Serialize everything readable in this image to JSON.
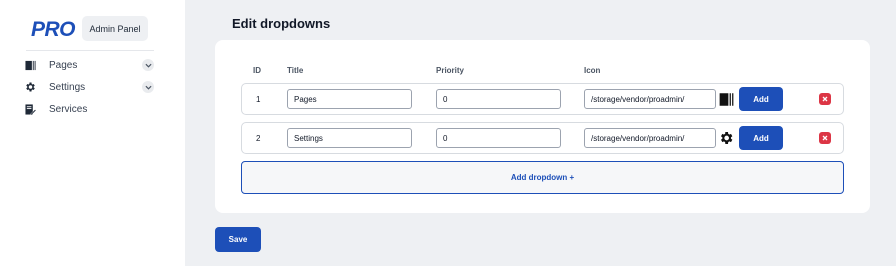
{
  "brand": {
    "logo": "PRO",
    "badge": "Admin Panel"
  },
  "sidebar": {
    "items": [
      {
        "label": "Pages",
        "icon": "book-icon",
        "has_chevron": true
      },
      {
        "label": "Settings",
        "icon": "gear-icon",
        "has_chevron": true
      },
      {
        "label": "Services",
        "icon": "edit-document-icon",
        "has_chevron": false
      }
    ]
  },
  "main": {
    "title": "Edit dropdowns",
    "columns": {
      "id": "ID",
      "title": "Title",
      "priority": "Priority",
      "icon": "Icon"
    },
    "rows": [
      {
        "id": "1",
        "title": "Pages",
        "priority": "0",
        "icon_path": "/storage/vendor/proadmin/",
        "icon": "book-icon",
        "add_label": "Add"
      },
      {
        "id": "2",
        "title": "Settings",
        "priority": "0",
        "icon_path": "/storage/vendor/proadmin/",
        "icon": "gear-icon",
        "add_label": "Add"
      }
    ],
    "add_dropdown_label": "Add dropdown +",
    "save_label": "Save"
  },
  "colors": {
    "accent": "#1d4fb8",
    "danger": "#dc3545",
    "background": "#eef0f3"
  }
}
